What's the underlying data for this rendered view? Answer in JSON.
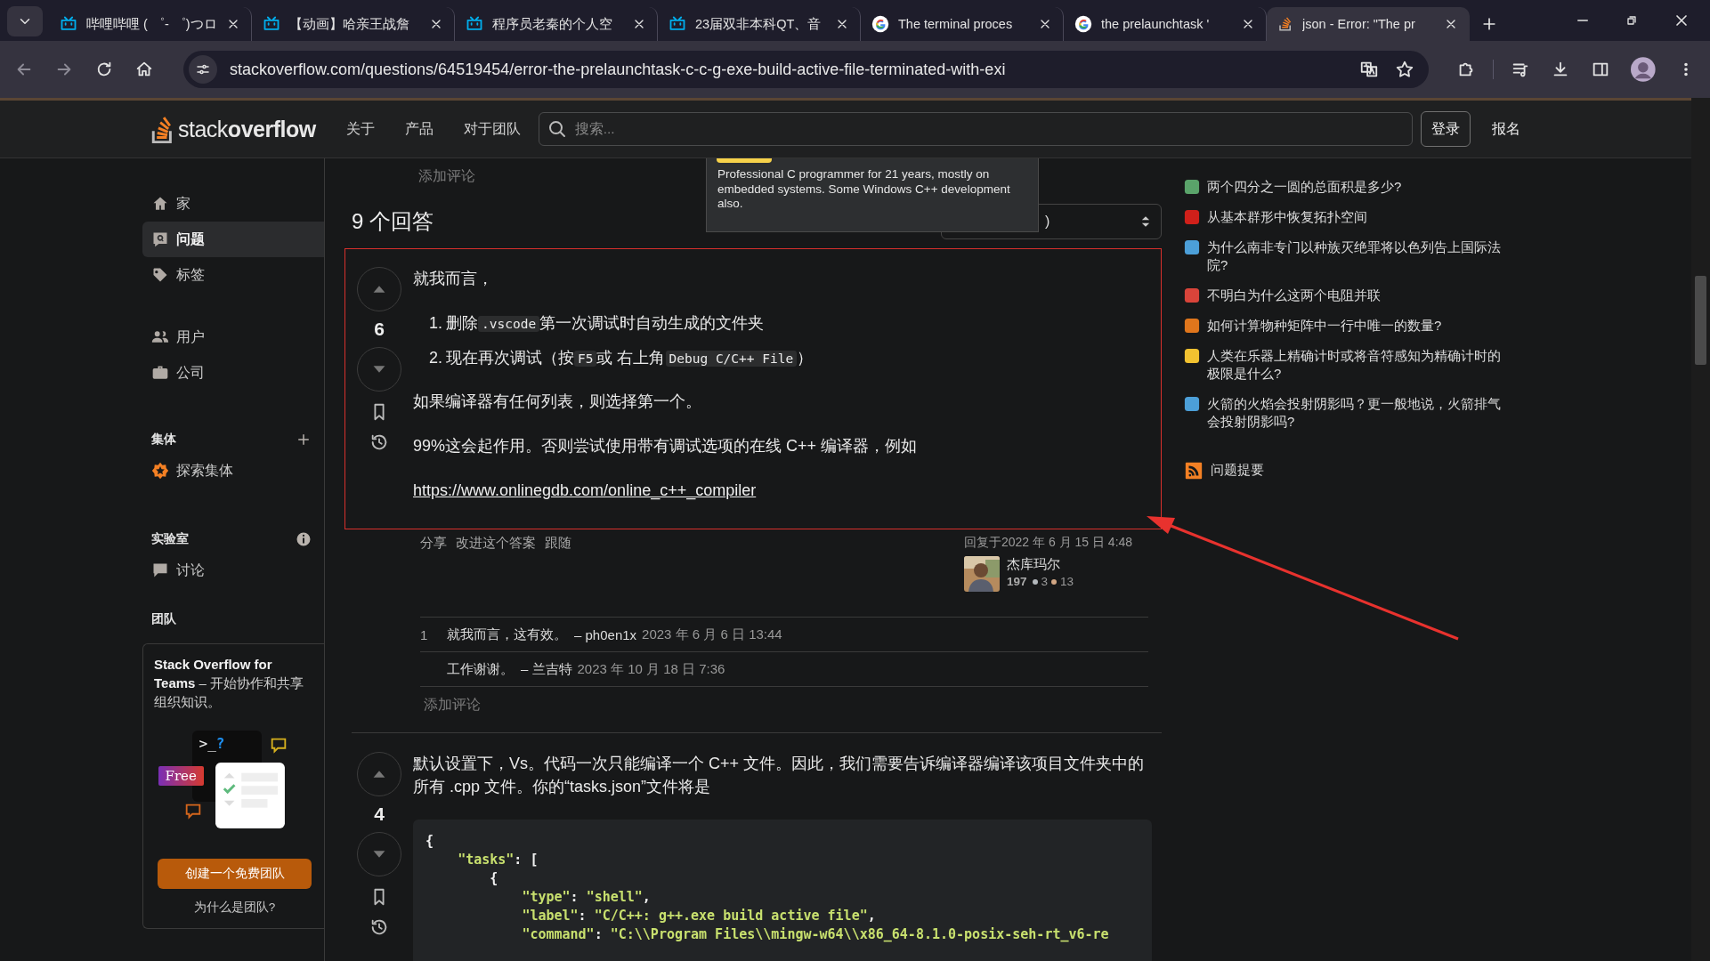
{
  "browser": {
    "tabs": [
      {
        "title": "哔哩哔哩 ( ゜- ゜)つロ",
        "selected": false
      },
      {
        "title": "【动画】哈亲王战詹",
        "selected": false
      },
      {
        "title": "程序员老秦的个人空",
        "selected": false
      },
      {
        "title": "23届双非本科QT、音",
        "selected": false
      },
      {
        "title": "The terminal proces",
        "selected": false
      },
      {
        "title": "the prelaunchtask '",
        "selected": false
      },
      {
        "title": "json - Error: \"The pr",
        "selected": true
      }
    ],
    "url": "stackoverflow.com/questions/64519454/error-the-prelaunchtask-c-c-g-exe-build-active-file-terminated-with-exi"
  },
  "header": {
    "logo": {
      "light": "stack",
      "bold": "overflow"
    },
    "nav": [
      "关于",
      "产品",
      "对于团队"
    ],
    "search": {
      "placeholder": "搜索..."
    },
    "login": "登录",
    "signup": "报名"
  },
  "sidebar": {
    "items": [
      {
        "label": "家",
        "selected": false
      },
      {
        "label": "问题",
        "selected": true
      },
      {
        "label": "标签",
        "selected": false
      }
    ],
    "items2": [
      {
        "label": "用户",
        "selected": false
      },
      {
        "label": "公司",
        "selected": false
      }
    ],
    "collectives": {
      "title": "集体",
      "item": "探索集体"
    },
    "labs": {
      "title": "实验室",
      "item": "讨论"
    },
    "teams": {
      "title": "团队",
      "text": "**Stack Overflow for Teams** – 开始协作和共享组织知识。",
      "prompt": ">_",
      "prompt_mark": "?",
      "badge": "Free",
      "button": "创建一个免费团队",
      "link": "为什么是团队?"
    }
  },
  "main": {
    "top_add_comment": "添加评论",
    "heading": "9 个回答",
    "sort_select": {
      "value": ")"
    },
    "tooltip": "Professional C programmer for 21 years, mostly on embedded systems. Some Windows C++ development also.",
    "answers": [
      {
        "votes": "6",
        "highlighted": true,
        "body": [
          {
            "kind": "p",
            "text": "就我而言，"
          },
          {
            "kind": "ol",
            "items": [
              {
                "marker": "1.",
                "segments": [
                  {
                    "kind": "text",
                    "text": "删除"
                  },
                  {
                    "kind": "code",
                    "text": ".vscode"
                  },
                  {
                    "kind": "text",
                    "text": "第一次调试时自动生成的文件夹"
                  }
                ]
              },
              {
                "marker": "2.",
                "segments": [
                  {
                    "kind": "text",
                    "text": "现在再次调试（按"
                  },
                  {
                    "kind": "code",
                    "text": "F5"
                  },
                  {
                    "kind": "text",
                    "text": "或 右上角"
                  },
                  {
                    "kind": "code",
                    "text": "Debug C/C++ File"
                  },
                  {
                    "kind": "text",
                    "text": "）"
                  }
                ]
              }
            ]
          },
          {
            "kind": "p",
            "text": "如果编译器有任何列表，则选择第一个。"
          },
          {
            "kind": "p",
            "text": "99%这会起作用。否则尝试使用带有调试选项的在线 C++ 编译器，例如"
          },
          {
            "kind": "link",
            "text": "https://www.onlinegdb.com/online_c++_compiler"
          }
        ],
        "actions": [
          "分享",
          "改进这个答案",
          "跟随"
        ],
        "answered": "回复于2022 年 6 月 15 日 4:48",
        "user": {
          "name": "杰库玛尔",
          "rep": "197",
          "silver": "3",
          "bronze": "13"
        },
        "comments": [
          {
            "score": "1",
            "text": "就我而言，这有效。",
            "author": "– ph0en1x",
            "date": "2023 年 6 月 6 日 13:44"
          },
          {
            "text": "工作谢谢。",
            "author": "– 兰吉特",
            "date": "2023 年 10 月 18 日 7:36"
          }
        ],
        "add_comment": "添加评论"
      },
      {
        "votes": "4",
        "highlighted": false,
        "body": [
          {
            "kind": "p",
            "text": "默认设置下，Vs。代码一次只能编译一个 C++ 文件。因此，我们需要告诉编译器编译该项目文件夹中的所有 .cpp 文件。你的“tasks.json”文件将是"
          },
          {
            "kind": "code",
            "lines": [
              "{",
              "    \"tasks\": [",
              "        {",
              "            \"type\": \"shell\",",
              "            \"label\": \"C/C++: g++.exe build active file\",",
              "            \"command\": \"C:\\\\Program Files\\\\mingw-w64\\\\x86_64-8.1.0-posix-seh-rt_v6-re"
            ]
          }
        ]
      }
    ]
  },
  "hot": {
    "items": [
      {
        "title": "两个四分之一圆的总面积是多少?",
        "color": "#5aa36a"
      },
      {
        "title": "从基本群形中恢复拓扑空间",
        "color": "#d0201a"
      },
      {
        "title": "为什么南非专门以种族灭绝罪将以色列告上国际法院?",
        "color": "#4c9fd8"
      },
      {
        "title": "不明白为什么这两个电阻并联",
        "color": "#d9443a"
      },
      {
        "title": "如何计算物种矩阵中一行中唯一的数量?",
        "color": "#e0761c"
      },
      {
        "title": "人类在乐器上精确计时或将音符感知为精确计时的极限是什么?",
        "color": "#f2c230"
      },
      {
        "title": "火箭的火焰会投射阴影吗？更一般地说，火箭排气会投射阴影吗?",
        "color": "#4c9fd8"
      }
    ],
    "feed": "问题提要"
  }
}
